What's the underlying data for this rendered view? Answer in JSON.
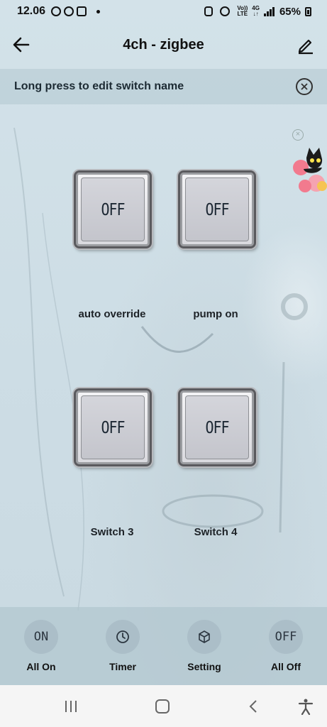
{
  "status_bar": {
    "time": "12.06",
    "network_top": "Vo))",
    "network_bottom": "LTE",
    "gen_top": "4G",
    "gen_bottom": "↓↑",
    "battery": "65%"
  },
  "header": {
    "title": "4ch - zigbee"
  },
  "banner": {
    "text": "Long press to edit switch name"
  },
  "switches": [
    {
      "label": "auto override",
      "state": "OFF"
    },
    {
      "label": "pump on",
      "state": "OFF"
    },
    {
      "label": "Switch 3",
      "state": "OFF"
    },
    {
      "label": "Switch 4",
      "state": "OFF"
    }
  ],
  "actions": [
    {
      "label": "All On",
      "icon_text": "ON",
      "icon": "power-on"
    },
    {
      "label": "Timer",
      "icon_text": "",
      "icon": "clock-icon"
    },
    {
      "label": "Setting",
      "icon_text": "",
      "icon": "cube-icon"
    },
    {
      "label": "All Off",
      "icon_text": "OFF",
      "icon": "power-off"
    }
  ],
  "colors": {
    "background": "#cfdfe6",
    "switch_face": "#c9cad1",
    "text": "#111111"
  }
}
